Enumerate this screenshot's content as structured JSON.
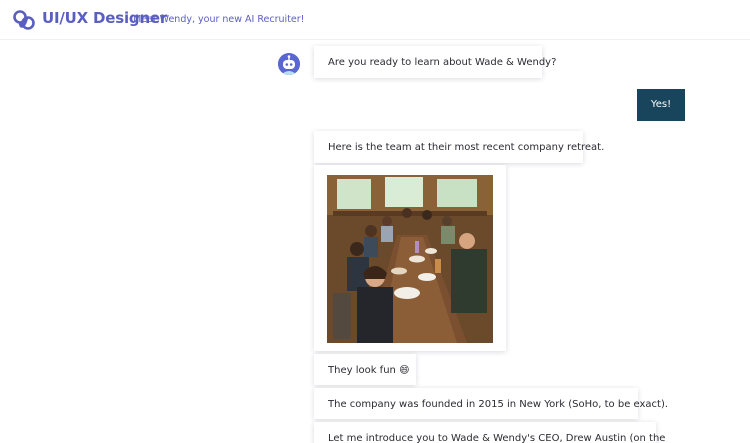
{
  "header": {
    "brand": "UI/UX Designer",
    "tagline": "Meet Wendy, your new AI Recruiter!",
    "logo_icon": "pretzel-logo-icon",
    "accent_color": "#5a5fbf"
  },
  "conversation": {
    "bot_avatar_icon": "robot-avatar-icon",
    "messages": [
      {
        "sender": "bot",
        "text": "Are you ready to learn about Wade & Wendy?"
      },
      {
        "sender": "user",
        "text": "Yes!"
      },
      {
        "sender": "bot",
        "text": "Here is the team at their most recent company retreat."
      },
      {
        "sender": "bot",
        "type": "image",
        "image_icon": "team-retreat-photo"
      },
      {
        "sender": "bot",
        "text": "They look fun",
        "emoji": "😄"
      },
      {
        "sender": "bot",
        "text": "The company was founded in 2015 in New York (SoHo, to be exact)."
      },
      {
        "sender": "bot",
        "text": "Let me introduce you to Wade & Wendy's CEO, Drew Austin (on the"
      }
    ],
    "user_bubble_color": "#19455c"
  }
}
